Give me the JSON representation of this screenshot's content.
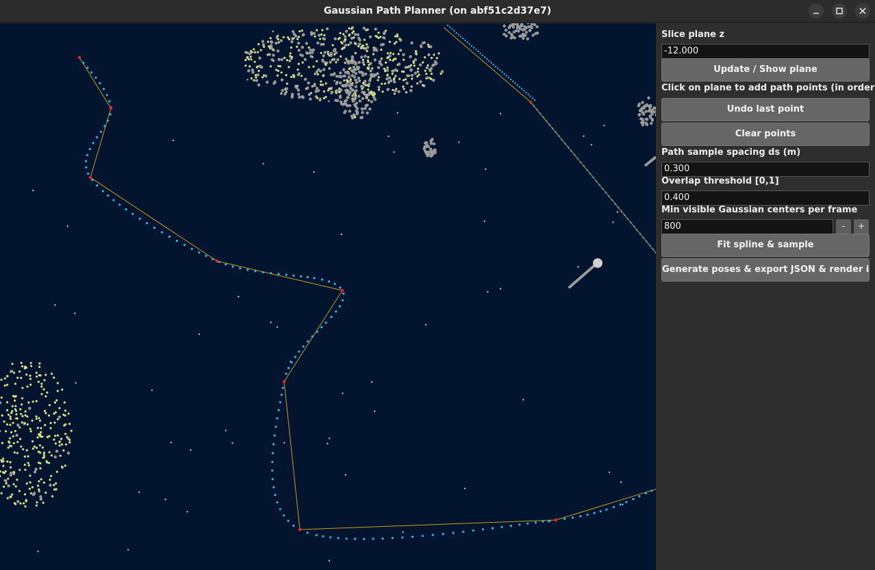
{
  "window": {
    "title": "Gaussian Path Planner (on abf51c2d37e7)",
    "minimize_icon": "minimize-icon",
    "maximize_icon": "maximize-icon",
    "close_icon": "close-icon"
  },
  "panel": {
    "slice_label": "Slice plane z",
    "slice_value": "-12.000",
    "update_button": "Update / Show plane",
    "instructions": "Click on plane to add path points (in order)",
    "undo_button": "Undo last point",
    "clear_button": "Clear points",
    "spacing_label": "Path sample spacing ds (m)",
    "spacing_value": "0.300",
    "overlap_label": "Overlap threshold [0,1]",
    "overlap_value": "0.400",
    "min_visible_label": "Min visible Gaussian centers per frame",
    "min_visible_value": "800",
    "decrement": "-",
    "increment": "+",
    "fit_button": "Fit spline & sample",
    "generate_button": "Generate poses & export JSON & render images"
  },
  "viewport": {
    "background_color": "#02142e",
    "control_line_color": "#c8a020",
    "control_point_color": "#ff2020",
    "sample_color": "#2cb7ea",
    "cluster_color_light": "#d8e08a",
    "cluster_color_gray": "#9a9a9a"
  }
}
